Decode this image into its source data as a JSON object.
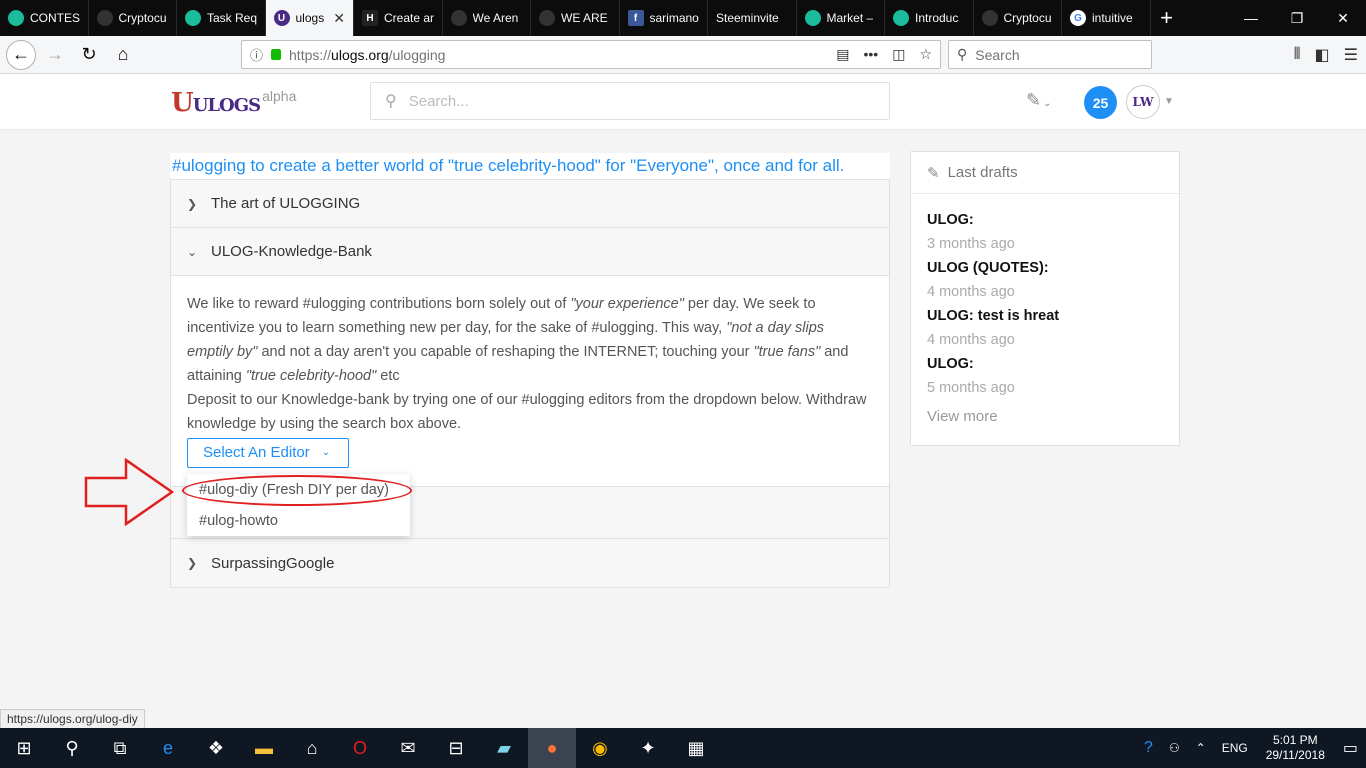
{
  "browser": {
    "tabs": [
      {
        "label": "CONTES",
        "color": "#1abc9c"
      },
      {
        "label": "Cryptocu",
        "color": "#333"
      },
      {
        "label": "Task Req",
        "color": "#1abc9c"
      },
      {
        "label": "ulogs",
        "color": "#4a2a85",
        "active": true
      },
      {
        "label": "Create ar",
        "color": "#222"
      },
      {
        "label": "We Aren",
        "color": "#333"
      },
      {
        "label": "WE ARE",
        "color": "#333"
      },
      {
        "label": "sarimano",
        "color": "#3b5998"
      },
      {
        "label": "Steeminvite",
        "color": "#0c0c0d"
      },
      {
        "label": "Market –",
        "color": "#1abc9c"
      },
      {
        "label": "Introduc",
        "color": "#1abc9c"
      },
      {
        "label": "Cryptocu",
        "color": "#333"
      },
      {
        "label": "intuitive",
        "color": "#ffffff"
      }
    ],
    "url_prefix": "https://",
    "url_host": "ulogs.org",
    "url_path": "/ulogging",
    "search_placeholder": "Search",
    "status_link": "https://ulogs.org/ulog-diy"
  },
  "site": {
    "logo_text": "ULOGS",
    "logo_tag": "alpha",
    "search_placeholder": "Search...",
    "notification_count": "25"
  },
  "main": {
    "headline": "#ulogging to create a better world of \"true celebrity-hood\" for \"Everyone\", once and for all.",
    "sections": [
      {
        "label": "The art of ULOGGING",
        "expanded": false
      },
      {
        "label": "ULOG-Knowledge-Bank",
        "expanded": true
      },
      {
        "label": "SurpassingGoogle",
        "expanded": false
      }
    ],
    "body": {
      "p1_a": "We like to reward #ulogging contributions born solely out of ",
      "p1_em1": "\"your experience\"",
      "p1_b": " per day. We seek to incentivize you to learn something new per day, for the sake of #ulogging. This way, ",
      "p1_em2": "\"not a day slips emptily by\"",
      "p1_c": " and not a day aren't you capable of reshaping the INTERNET; touching your ",
      "p1_em3": "\"true fans\"",
      "p1_d": " and attaining ",
      "p1_em4": "\"true celebrity-hood\"",
      "p1_e": " etc",
      "p2": "Deposit to our Knowledge-bank by trying one of our #ulogging editors from the dropdown below. Withdraw knowledge by using the search box above."
    },
    "select_label": "Select An Editor",
    "dropdown_items": [
      "#ulog-diy (Fresh DIY per day)",
      "#ulog-howto"
    ]
  },
  "sidebar": {
    "title": "Last drafts",
    "drafts": [
      {
        "title": "ULOG:",
        "date": "3 months ago"
      },
      {
        "title": "ULOG (QUOTES):",
        "date": "4 months ago"
      },
      {
        "title": "ULOG: test is hreat",
        "date": "4 months ago"
      },
      {
        "title": "ULOG:",
        "date": "5 months ago"
      }
    ],
    "view_more": "View more"
  },
  "taskbar": {
    "lang": "ENG",
    "time": "5:01 PM",
    "date": "29/11/2018"
  },
  "colors": {
    "accent": "#1e8ff5",
    "annotation": "#e02020"
  }
}
